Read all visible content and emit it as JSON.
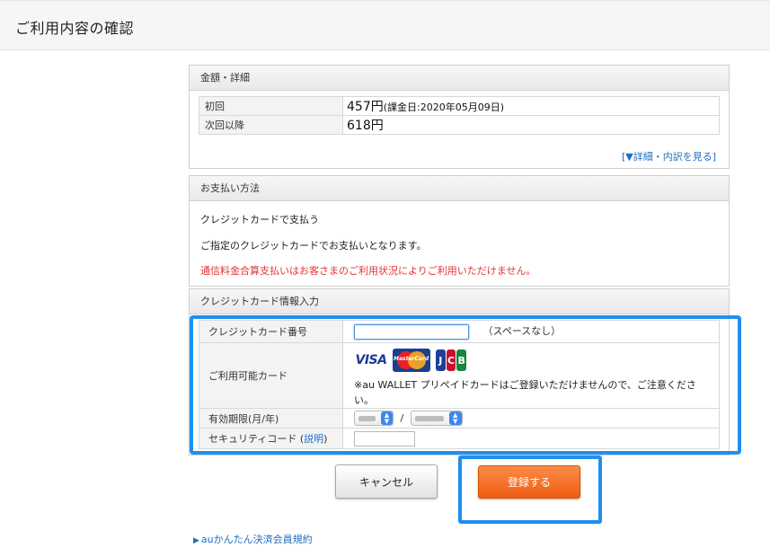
{
  "header": {
    "title": "ご利用内容の確認"
  },
  "amount_panel": {
    "heading": "金額・詳細",
    "rows": [
      {
        "label": "初回",
        "price": "457円",
        "note": "(課金日:2020年05月09日)"
      },
      {
        "label": "次回以降",
        "price": "618円",
        "note": ""
      }
    ],
    "detail_link": "[▼詳細・内訳を見る]"
  },
  "payment_panel": {
    "heading": "お支払い方法",
    "method": "クレジットカードで支払う",
    "description": "ご指定のクレジットカードでお支払いとなります。",
    "warning": "通信料金合算支払いはお客さまのご利用状況によりご利用いただけません。"
  },
  "card_panel": {
    "heading": "クレジットカード情報入力",
    "card_number_label": "クレジットカード番号",
    "card_number_value": "",
    "card_number_hint": "（スペースなし）",
    "available_cards_label": "ご利用可能カード",
    "brands": [
      "VISA",
      "MasterCard",
      "JCB"
    ],
    "available_note": "※au WALLET プリペイドカードはご登録いただけませんので、ご注意ください。",
    "expiry_label": "有効期限(月/年)",
    "expiry_separator": "/",
    "security_label": "セキュリティコード (",
    "security_link": "説明",
    "security_label_end": ")",
    "security_value": ""
  },
  "buttons": {
    "cancel": "キャンセル",
    "register": "登録する"
  },
  "footer": {
    "terms_link": "auかんたん決済会員規約"
  },
  "colors": {
    "link": "#1f6fbf",
    "warning": "#e53333",
    "highlight": "#1f8ff0",
    "primary_button": "#ef5d12"
  }
}
